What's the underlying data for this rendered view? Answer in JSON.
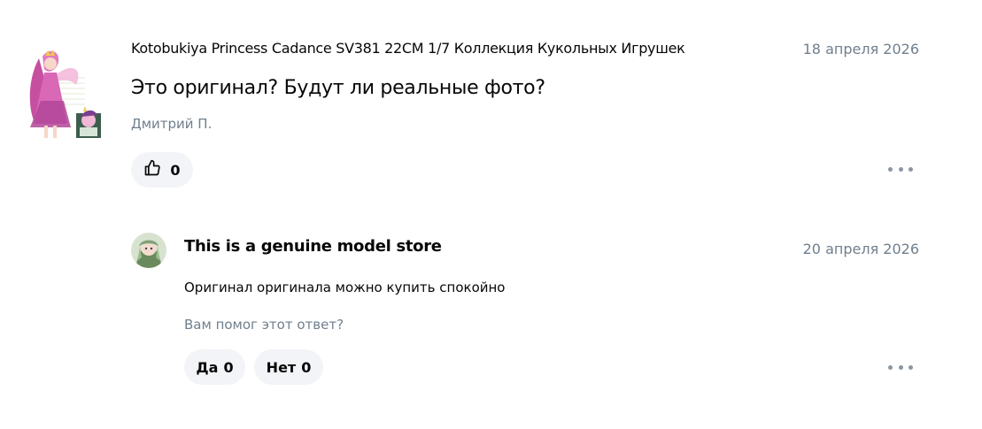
{
  "question": {
    "product_name": "Kotobukiya Princess Cadance SV381 22CM 1/7 Коллекция Кукольных Игрушек",
    "date": "18 апреля 2026",
    "text": "Это оригинал? Будут ли реальные фото?",
    "author": "Дмитрий П.",
    "likes": "0",
    "like_icon": "thumbs-up-icon",
    "more_icon": "more-dots-icon"
  },
  "answer": {
    "seller_name": "This is a genuine model store",
    "date": "20 апреля 2026",
    "text": "Оригинал оригинала можно купить спокойно",
    "helpful_prompt": "Вам помог этот ответ?",
    "yes_label": "Да",
    "yes_count": "0",
    "no_label": "Нет",
    "no_count": "0",
    "more_icon": "more-dots-icon"
  },
  "colors": {
    "text": "#070707",
    "muted": "#707f8d",
    "button_bg": "#f2f4f7",
    "dots": "#8a96a3"
  }
}
